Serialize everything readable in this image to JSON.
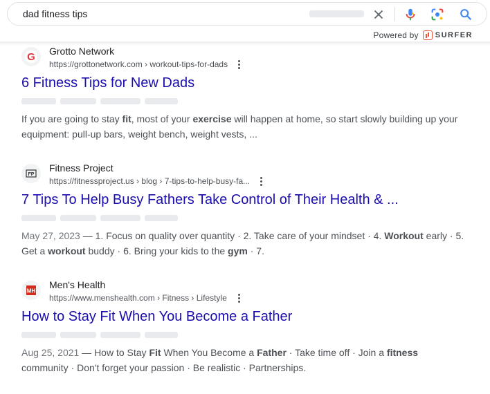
{
  "search": {
    "query": "dad fitness tips",
    "powered_by_label": "Powered by",
    "powered_by_brand": "SURFER",
    "icons": [
      "close-icon",
      "mic-icon",
      "lens-icon",
      "search-icon"
    ],
    "colors": {
      "mic_blue": "#4285f4",
      "mic_red": "#ea4335",
      "mic_yellow": "#fbbc04",
      "mic_green": "#34a853",
      "surfer_orange": "#e8553f"
    }
  },
  "results": [
    {
      "site_name": "Grotto Network",
      "url": "https://grottonetwork.com › workout-tips-for-dads",
      "title": "6 Fitness Tips for New Dads",
      "favicon": "grotto-logo-icon",
      "snippet": {
        "p1": "If you are going to stay ",
        "b1": "fit",
        "p2": ", most of your ",
        "b2": "exercise",
        "p3": " will happen at home, so start slowly building up your equipment: pull-up bars, weight bench, weight vests, ..."
      }
    },
    {
      "site_name": "Fitness Project",
      "url": "https://fitnessproject.us › blog › 7-tips-to-help-busy-fa...",
      "title": "7 Tips To Help Busy Fathers Take Control of Their Health & ...",
      "favicon": "fitness-project-logo-icon",
      "snippet": {
        "date": "May 27, 2023",
        "p1": " — 1. Focus on quality over quantity · 2. Take care of your mindset · 4. ",
        "b1": "Workout",
        "p2": " early · 5. Get a ",
        "b2": "workout",
        "p3": " buddy · 6. Bring your kids to the ",
        "b3": "gym",
        "p4": " · 7."
      }
    },
    {
      "site_name": "Men's Health",
      "url": "https://www.menshealth.com › Fitness › Lifestyle",
      "title": "How to Stay Fit When You Become a Father",
      "favicon": "mens-health-logo-icon",
      "snippet": {
        "date": "Aug 25, 2021",
        "p1": " — How to Stay ",
        "b1": "Fit",
        "p2": " When You Become a ",
        "b2": "Father",
        "p3": " · Take time off · Join a ",
        "b3": "fitness",
        "p4": " community · Don't forget your passion · Be realistic · Partnerships."
      }
    }
  ]
}
